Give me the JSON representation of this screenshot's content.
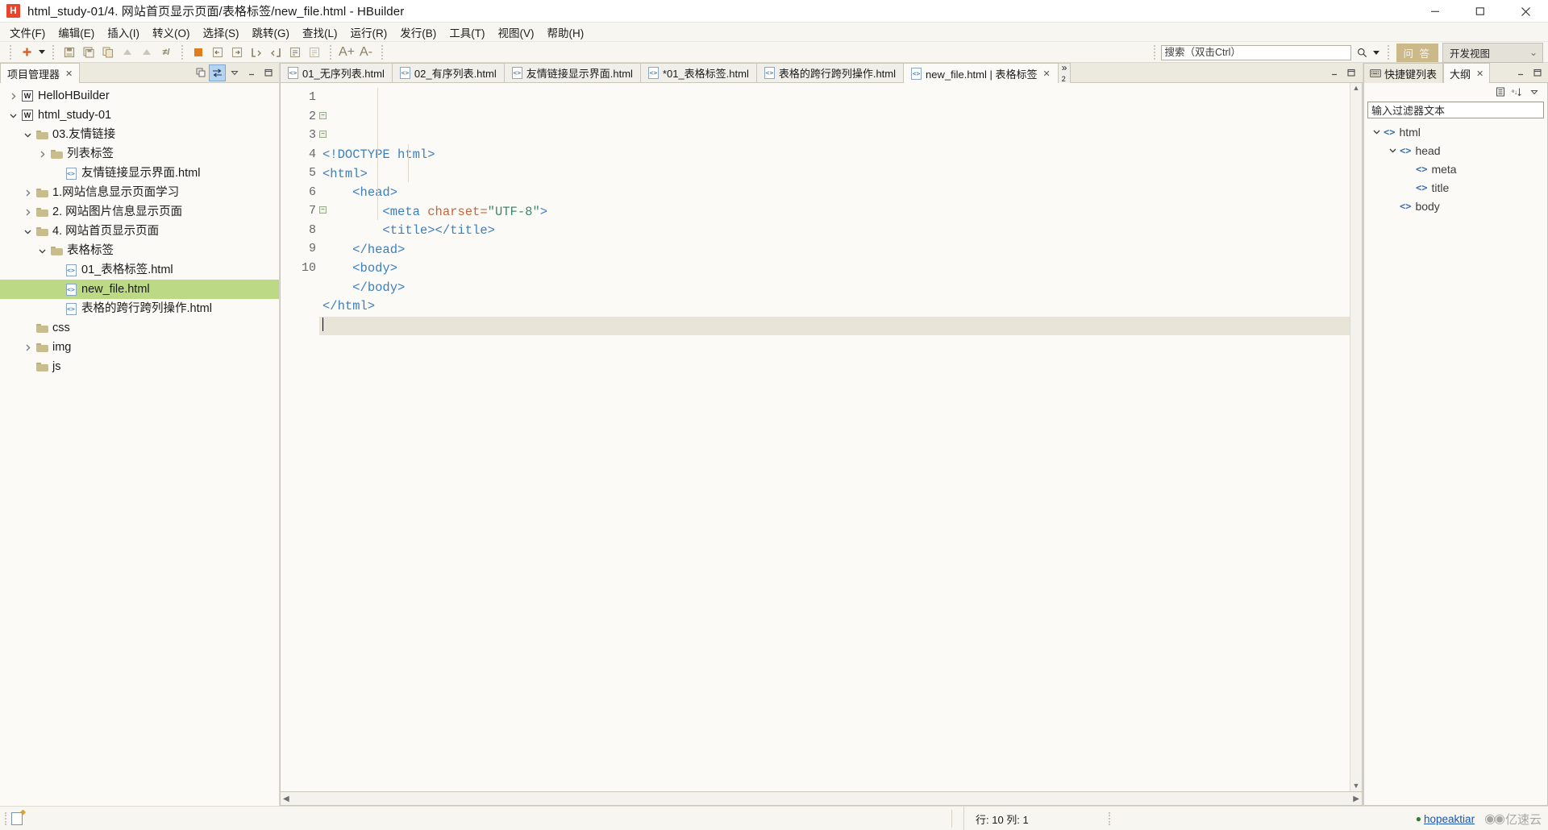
{
  "window": {
    "title": "html_study-01/4. 网站首页显示页面/表格标签/new_file.html  -  HBuilder",
    "logo_text": "H",
    "minimize_label": "最小化",
    "maximize_label": "最大化",
    "close_label": "关闭"
  },
  "menubar": {
    "items": [
      {
        "label": "文件(F)"
      },
      {
        "label": "编辑(E)"
      },
      {
        "label": "插入(I)"
      },
      {
        "label": "转义(O)"
      },
      {
        "label": "选择(S)"
      },
      {
        "label": "跳转(G)"
      },
      {
        "label": "查找(L)"
      },
      {
        "label": "运行(R)"
      },
      {
        "label": "发行(B)"
      },
      {
        "label": "工具(T)"
      },
      {
        "label": "视图(V)"
      },
      {
        "label": "帮助(H)"
      }
    ]
  },
  "toolbar": {
    "new_label": "新建",
    "save_label": "保存",
    "save_all_label": "全部保存",
    "copy_label": "复制",
    "undo_label": "撤销",
    "redo_label": "重做",
    "search": {
      "value": "搜索（双击Ctrl）",
      "placeholder": "搜索（双击Ctrl）"
    },
    "qa_button": "问 答",
    "view_select": "开发视图",
    "view_chevron": "⌄",
    "font_bigger": "A+",
    "font_smaller": "A-"
  },
  "left_panel": {
    "tab": {
      "label": "项目管理器",
      "close": "✕"
    },
    "tools": [
      {
        "name": "collapse-all-icon"
      },
      {
        "name": "link-editor-icon"
      },
      {
        "name": "view-menu-icon"
      },
      {
        "name": "minimize-icon"
      },
      {
        "name": "maximize-icon"
      }
    ],
    "tree": [
      {
        "depth": 0,
        "twist": "collapsed",
        "icon": "project",
        "label": "HelloHBuilder",
        "selected": false
      },
      {
        "depth": 0,
        "twist": "expanded",
        "icon": "project",
        "label": "html_study-01",
        "selected": false
      },
      {
        "depth": 1,
        "twist": "expanded",
        "icon": "folder",
        "label": "03.友情链接",
        "selected": false
      },
      {
        "depth": 2,
        "twist": "collapsed",
        "icon": "folder",
        "label": "列表标签",
        "selected": false
      },
      {
        "depth": 3,
        "twist": "none",
        "icon": "html",
        "label": "友情链接显示界面.html",
        "selected": false
      },
      {
        "depth": 1,
        "twist": "collapsed",
        "icon": "folder",
        "label": "1.网站信息显示页面学习",
        "selected": false
      },
      {
        "depth": 1,
        "twist": "collapsed",
        "icon": "folder",
        "label": "2. 网站图片信息显示页面",
        "selected": false
      },
      {
        "depth": 1,
        "twist": "expanded",
        "icon": "folder",
        "label": "4. 网站首页显示页面",
        "selected": false
      },
      {
        "depth": 2,
        "twist": "expanded",
        "icon": "folder",
        "label": "表格标签",
        "selected": false
      },
      {
        "depth": 3,
        "twist": "none",
        "icon": "html",
        "label": "01_表格标签.html",
        "selected": false
      },
      {
        "depth": 3,
        "twist": "none",
        "icon": "html",
        "label": "new_file.html",
        "selected": true
      },
      {
        "depth": 3,
        "twist": "none",
        "icon": "html",
        "label": "表格的跨行跨列操作.html",
        "selected": false
      },
      {
        "depth": 1,
        "twist": "none",
        "icon": "folder",
        "label": "css",
        "selected": false
      },
      {
        "depth": 1,
        "twist": "collapsed",
        "icon": "folder",
        "label": "img",
        "selected": false
      },
      {
        "depth": 1,
        "twist": "none",
        "icon": "folder",
        "label": "js",
        "selected": false
      }
    ]
  },
  "editor": {
    "tabs": [
      {
        "label": "01_无序列表.html",
        "active": false,
        "closable": false
      },
      {
        "label": "02_有序列表.html",
        "active": false,
        "closable": false
      },
      {
        "label": "友情链接显示界面.html",
        "active": false,
        "closable": false
      },
      {
        "label": "*01_表格标签.html",
        "active": false,
        "closable": false
      },
      {
        "label": "表格的跨行跨列操作.html",
        "active": false,
        "closable": false
      },
      {
        "label": "new_file.html | 表格标签",
        "active": true,
        "closable": true,
        "close": "✕"
      }
    ],
    "overflow_label": "»",
    "overflow_count": "2",
    "lines": [
      {
        "n": "1",
        "fold": "",
        "current": false,
        "tokens": [
          {
            "t": "<!DOCTYPE html>",
            "c": "k-dtd"
          }
        ]
      },
      {
        "n": "2",
        "fold": "−",
        "current": false,
        "tokens": [
          {
            "t": "<html>",
            "c": "k-tag"
          }
        ]
      },
      {
        "n": "3",
        "fold": "−",
        "current": false,
        "tokens": [
          {
            "t": "    ",
            "c": "k-punc"
          },
          {
            "t": "<head>",
            "c": "k-tag"
          }
        ]
      },
      {
        "n": "4",
        "fold": "",
        "current": false,
        "tokens": [
          {
            "t": "        ",
            "c": "k-punc"
          },
          {
            "t": "<meta ",
            "c": "k-tag"
          },
          {
            "t": "charset=",
            "c": "k-attr"
          },
          {
            "t": "\"UTF-8\"",
            "c": "k-str"
          },
          {
            "t": ">",
            "c": "k-tag"
          }
        ]
      },
      {
        "n": "5",
        "fold": "",
        "current": false,
        "tokens": [
          {
            "t": "        ",
            "c": "k-punc"
          },
          {
            "t": "<title></title>",
            "c": "k-tag"
          }
        ]
      },
      {
        "n": "6",
        "fold": "",
        "current": false,
        "tokens": [
          {
            "t": "    ",
            "c": "k-punc"
          },
          {
            "t": "</head>",
            "c": "k-tag"
          }
        ]
      },
      {
        "n": "7",
        "fold": "−",
        "current": false,
        "tokens": [
          {
            "t": "    ",
            "c": "k-punc"
          },
          {
            "t": "<body>",
            "c": "k-tag"
          }
        ]
      },
      {
        "n": "8",
        "fold": "",
        "current": false,
        "tokens": [
          {
            "t": "    ",
            "c": "k-punc"
          },
          {
            "t": "</body>",
            "c": "k-tag"
          }
        ]
      },
      {
        "n": "9",
        "fold": "",
        "current": false,
        "tokens": [
          {
            "t": "</html>",
            "c": "k-tag"
          }
        ]
      },
      {
        "n": "10",
        "fold": "",
        "current": true,
        "tokens": []
      }
    ]
  },
  "right_panel": {
    "tabs": [
      {
        "label": "快捷键列表",
        "active": false,
        "closable": false,
        "icon": "keyboard-icon"
      },
      {
        "label": "大纲",
        "active": true,
        "closable": true,
        "close": "✕"
      }
    ],
    "tools": [
      {
        "name": "flat-view-icon",
        "glyph": "▤"
      },
      {
        "name": "sort-icon",
        "glyph": "⇅"
      },
      {
        "name": "view-menu-icon",
        "glyph": "▽"
      }
    ],
    "minimize_label": "最小化",
    "maximize_label": "最大化",
    "filter": {
      "value": "输入过滤器文本",
      "placeholder": "输入过滤器文本"
    },
    "outline": [
      {
        "depth": 0,
        "twist": "expanded",
        "label": "html"
      },
      {
        "depth": 1,
        "twist": "expanded",
        "label": "head"
      },
      {
        "depth": 2,
        "twist": "none",
        "label": "meta"
      },
      {
        "depth": 2,
        "twist": "none",
        "label": "title"
      },
      {
        "depth": 1,
        "twist": "none",
        "label": "body"
      }
    ]
  },
  "statusbar": {
    "cursor_position": "行: 10 列: 1",
    "user": "hopeaktiar",
    "watermark": "亿速云"
  },
  "colors": {
    "accent_selected": "#bcd986",
    "tab_accent": "#ccb98a",
    "link": "#1a56b0",
    "logo": "#e8452c"
  }
}
